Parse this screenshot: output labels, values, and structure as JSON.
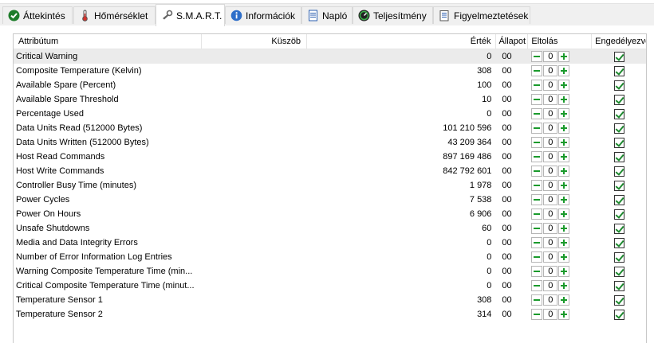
{
  "tabs": [
    {
      "label": "Áttekintés",
      "icon": "check-circle-icon"
    },
    {
      "label": "Hőmérséklet",
      "icon": "thermometer-icon"
    },
    {
      "label": "S.M.A.R.T.",
      "icon": "smart-wrench-icon"
    },
    {
      "label": "Információk",
      "icon": "info-icon"
    },
    {
      "label": "Napló",
      "icon": "log-document-icon"
    },
    {
      "label": "Teljesítmény",
      "icon": "performance-gauge-icon"
    },
    {
      "label": "Figyelmeztetések",
      "icon": "alerts-document-icon"
    }
  ],
  "active_tab": "S.M.A.R.T.",
  "columns": {
    "attribute": "Attribútum",
    "threshold": "Küszöb",
    "value": "Érték",
    "status": "Állapot",
    "offset": "Eltolás",
    "enabled": "Engedélyezve"
  },
  "colors": {
    "accent_green": "#1a9a2c",
    "selected_row": "#ebebeb"
  },
  "rows": [
    {
      "attribute": "Critical Warning",
      "value": "0",
      "status": "00",
      "offset": "0",
      "enabled": true
    },
    {
      "attribute": "Composite Temperature (Kelvin)",
      "value": "308",
      "status": "00",
      "offset": "0",
      "enabled": true
    },
    {
      "attribute": "Available Spare (Percent)",
      "value": "100",
      "status": "00",
      "offset": "0",
      "enabled": true
    },
    {
      "attribute": "Available Spare Threshold",
      "value": "10",
      "status": "00",
      "offset": "0",
      "enabled": true
    },
    {
      "attribute": "Percentage Used",
      "value": "0",
      "status": "00",
      "offset": "0",
      "enabled": true
    },
    {
      "attribute": "Data Units Read (512000 Bytes)",
      "value": "101 210 596",
      "status": "00",
      "offset": "0",
      "enabled": true
    },
    {
      "attribute": "Data Units Written (512000 Bytes)",
      "value": "43 209 364",
      "status": "00",
      "offset": "0",
      "enabled": true
    },
    {
      "attribute": "Host Read Commands",
      "value": "897 169 486",
      "status": "00",
      "offset": "0",
      "enabled": true
    },
    {
      "attribute": "Host Write Commands",
      "value": "842 792 601",
      "status": "00",
      "offset": "0",
      "enabled": true
    },
    {
      "attribute": "Controller Busy Time (minutes)",
      "value": "1 978",
      "status": "00",
      "offset": "0",
      "enabled": true
    },
    {
      "attribute": "Power Cycles",
      "value": "7 538",
      "status": "00",
      "offset": "0",
      "enabled": true
    },
    {
      "attribute": "Power On Hours",
      "value": "6 906",
      "status": "00",
      "offset": "0",
      "enabled": true
    },
    {
      "attribute": "Unsafe Shutdowns",
      "value": "60",
      "status": "00",
      "offset": "0",
      "enabled": true
    },
    {
      "attribute": "Media and Data Integrity Errors",
      "value": "0",
      "status": "00",
      "offset": "0",
      "enabled": true
    },
    {
      "attribute": "Number of Error Information Log Entries",
      "value": "0",
      "status": "00",
      "offset": "0",
      "enabled": true
    },
    {
      "attribute": "Warning Composite Temperature Time (min...",
      "value": "0",
      "status": "00",
      "offset": "0",
      "enabled": true
    },
    {
      "attribute": "Critical Composite Temperature Time (minut...",
      "value": "0",
      "status": "00",
      "offset": "0",
      "enabled": true
    },
    {
      "attribute": "Temperature Sensor 1",
      "value": "308",
      "status": "00",
      "offset": "0",
      "enabled": true
    },
    {
      "attribute": "Temperature Sensor 2",
      "value": "314",
      "status": "00",
      "offset": "0",
      "enabled": true
    }
  ]
}
